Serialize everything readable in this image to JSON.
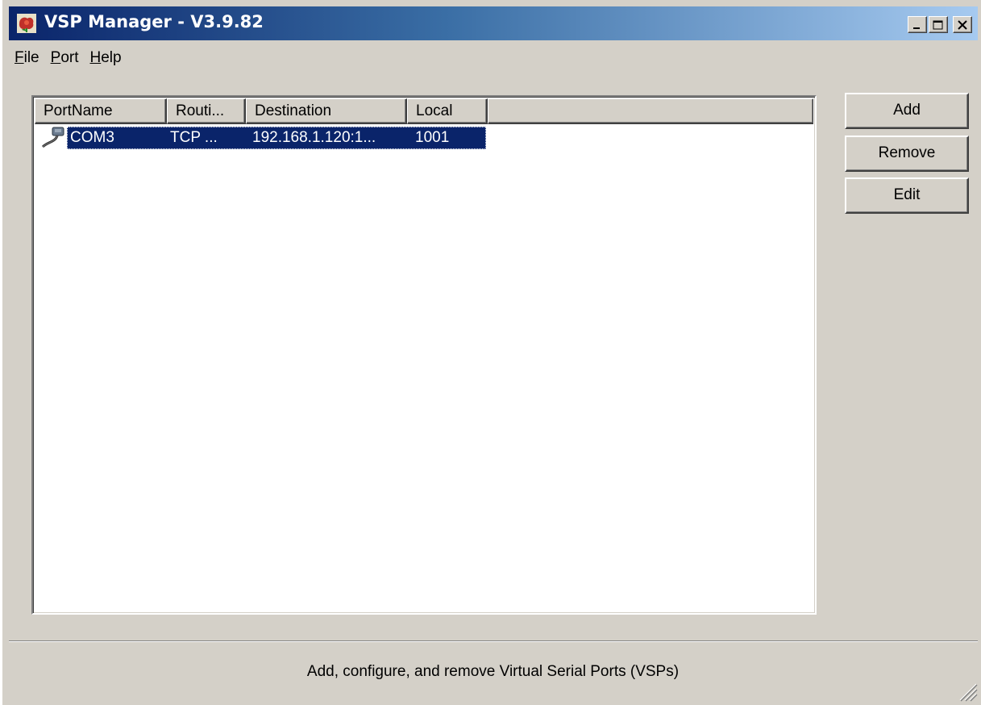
{
  "window": {
    "title": "VSP Manager - V3.9.82",
    "controls": {
      "minimize": "_",
      "maximize": "□",
      "close": "×"
    }
  },
  "menu": {
    "items": [
      {
        "label_ul": "F",
        "label_rest": "ile"
      },
      {
        "label_ul": "P",
        "label_rest": "ort"
      },
      {
        "label_ul": "H",
        "label_rest": "elp"
      }
    ]
  },
  "ports_table": {
    "columns": [
      "PortName",
      "Routi...",
      "Destination",
      "Local"
    ],
    "rows": [
      {
        "port_name": "COM3",
        "routing": "TCP ...",
        "destination": "192.168.1.120:1...",
        "local": "1001",
        "icon": "serial-port-icon",
        "selected": true
      }
    ]
  },
  "buttons": {
    "add": "Add",
    "remove": "Remove",
    "edit": "Edit"
  },
  "status": {
    "text": "Add, configure, and remove Virtual Serial Ports (VSPs)"
  },
  "colors": {
    "title_gradient_start": "#0a246a",
    "title_gradient_end": "#a6caf0",
    "selection": "#0a246a",
    "face": "#d4d0c8"
  }
}
